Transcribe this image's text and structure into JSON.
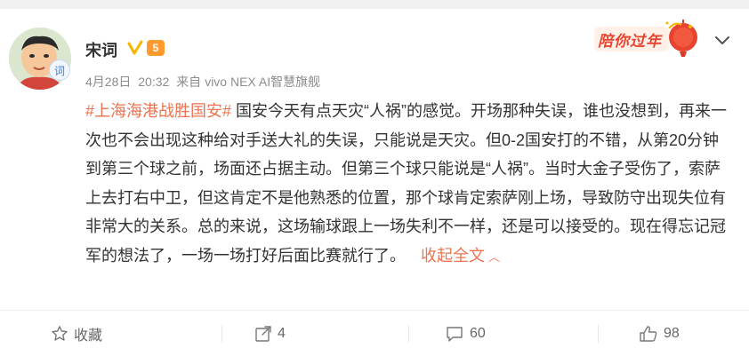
{
  "post": {
    "author": "宋词",
    "date": "4月28日",
    "time": "20:32",
    "via": "来自",
    "device": "vivo NEX AI智慧旗舰",
    "hashtag": "#上海海港战胜国安#",
    "body": "国安今天有点天灾“人祸”的感觉。开场那种失误，谁也没想到，再来一次也不会出现这种给对手送大礼的失误，只能说是天灾。但0-2国安打的不错，从第20分钟到第三个球之前，场面还占据主动。但第三个球只能说是“人祸”。当时大金子受伤了，索萨上去打右中卫，但这肯定不是他熟悉的位置，那个球肯定索萨刚上场，导致防守出现失位有非常大的关系。总的来说，这场输球跟上一场失利不一样，还是可以接受的。现在得忘记冠军的想法了，一场一场打好后面比赛就行了。",
    "collapse_label": "收起全文",
    "avatar_badge": "词"
  },
  "decoration": {
    "label": "陪你过年"
  },
  "badges": {
    "verified": "v-icon",
    "vip": "vip-icon",
    "vip_text": "5"
  },
  "actions": {
    "favorite_label": "收藏",
    "repost_count": "4",
    "comment_count": "60",
    "like_count": "98"
  },
  "colors": {
    "link": "#eb7350",
    "verified": "#f7b500",
    "decoration": "#e8432f"
  }
}
